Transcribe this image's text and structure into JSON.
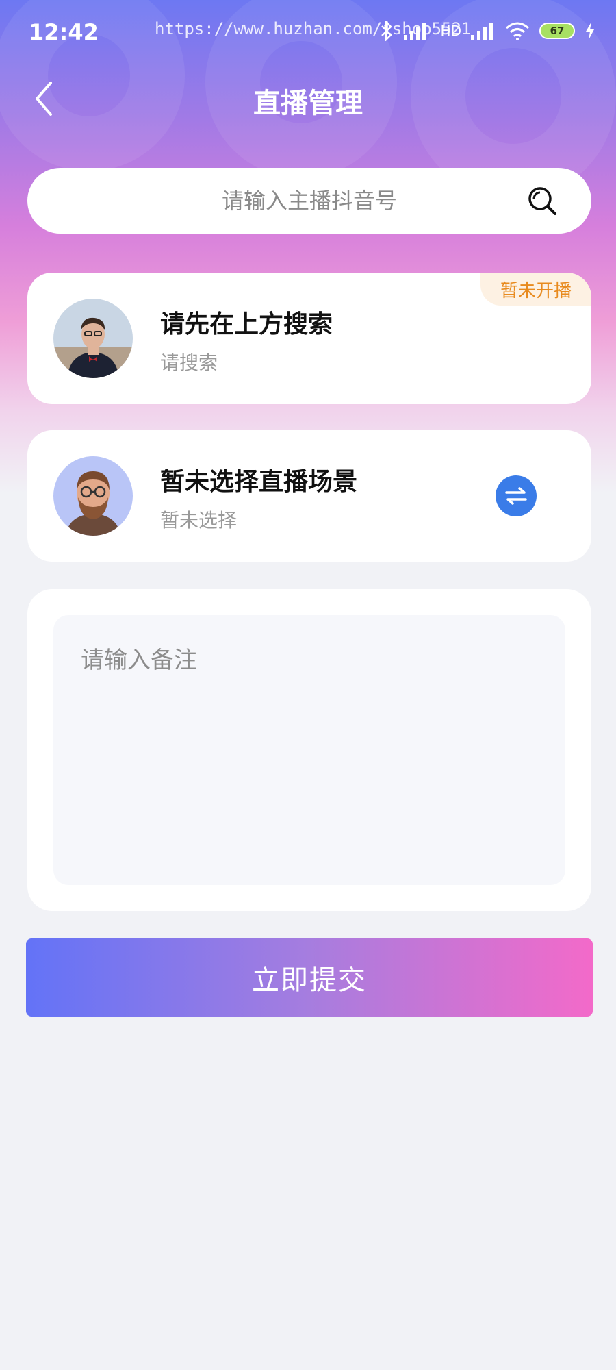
{
  "status_bar": {
    "time": "12:42",
    "watermark": "https://www.huzhan.com/ishop5521",
    "network_label": "HD",
    "battery": "67"
  },
  "nav": {
    "title": "直播管理"
  },
  "search": {
    "placeholder": "请输入主播抖音号"
  },
  "anchor_card": {
    "title": "请先在上方搜索",
    "subtitle": "请搜索",
    "badge": "暂未开播"
  },
  "scene_card": {
    "title": "暂未选择直播场景",
    "subtitle": "暂未选择"
  },
  "remark": {
    "placeholder": "请输入备注"
  },
  "submit": {
    "label": "立即提交"
  },
  "colors": {
    "accent_blue": "#3a7ce8",
    "badge_orange": "#e88a1e",
    "gradient_start": "#6373f7",
    "gradient_end": "#f36ac9",
    "page_bg": "#f1f2f6"
  }
}
